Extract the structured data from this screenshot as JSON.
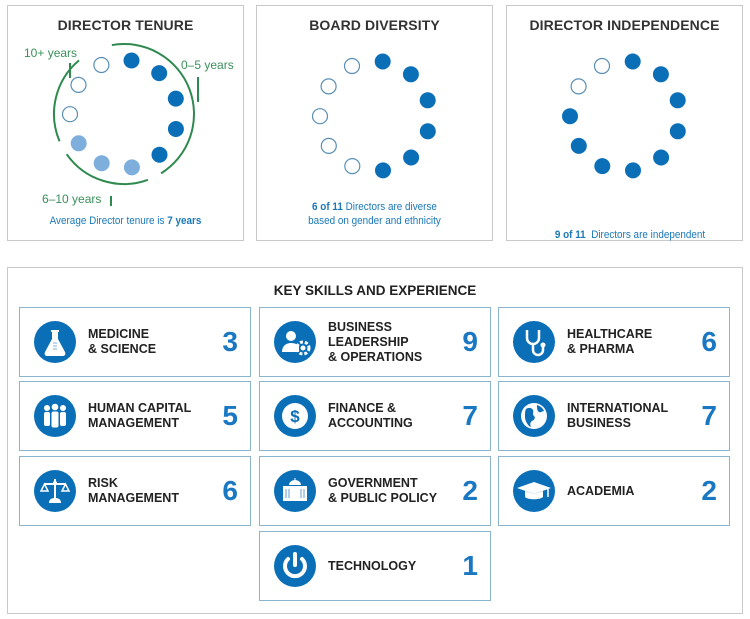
{
  "colors": {
    "blue": "#0b6fb8",
    "light_blue": "#7eaedc",
    "outline": "#5a8fb5",
    "green": "#2f8a4f",
    "tile_border": "#8ab4cf"
  },
  "tenure": {
    "title": "DIRECTOR TENURE",
    "labels": {
      "ten_plus": "10+ years",
      "zero_five": "0–5 years",
      "six_ten": "6–10 years"
    },
    "caption_prefix": "Average Director tenure is ",
    "caption_bold": "7 years",
    "dots": [
      "dark",
      "dark",
      "dark",
      "dark",
      "dark",
      "light",
      "light",
      "light",
      "outline",
      "outline",
      "outline"
    ],
    "groups": {
      "0-5 years": 5,
      "6-10 years": 3,
      "10+ years": 3
    }
  },
  "diversity": {
    "title": "BOARD DIVERSITY",
    "caption_bold": "6 of 11",
    "caption_line1": " Directors are diverse",
    "caption_line2": "based on gender and ethnicity",
    "filled": 6,
    "total": 11
  },
  "independence": {
    "title": "DIRECTOR INDEPENDENCE",
    "caption_bold": "9 of 11",
    "caption_rest": "  Directors are independent",
    "filled": 9,
    "total": 11
  },
  "skills": {
    "title": "KEY SKILLS AND EXPERIENCE",
    "items": [
      {
        "label": "MEDICINE\n& SCIENCE",
        "count": "3",
        "icon": "flask-icon"
      },
      {
        "label": "BUSINESS\nLEADERSHIP\n& OPERATIONS",
        "count": "9",
        "icon": "person-gear-icon"
      },
      {
        "label": "HEALTHCARE\n& PHARMA",
        "count": "6",
        "icon": "stethoscope-icon"
      },
      {
        "label": "HUMAN CAPITAL\nMANAGEMENT",
        "count": "5",
        "icon": "people-icon"
      },
      {
        "label": "FINANCE &\nACCOUNTING",
        "count": "7",
        "icon": "dollar-icon"
      },
      {
        "label": "INTERNATIONAL\nBUSINESS",
        "count": "7",
        "icon": "globe-icon"
      },
      {
        "label": "RISK\nMANAGEMENT",
        "count": "6",
        "icon": "scales-icon"
      },
      {
        "label": "GOVERNMENT\n& PUBLIC POLICY",
        "count": "2",
        "icon": "capitol-icon"
      },
      {
        "label": "ACADEMIA",
        "count": "2",
        "icon": "graduation-cap-icon"
      },
      {
        "label": "TECHNOLOGY",
        "count": "1",
        "icon": "power-icon"
      }
    ]
  }
}
